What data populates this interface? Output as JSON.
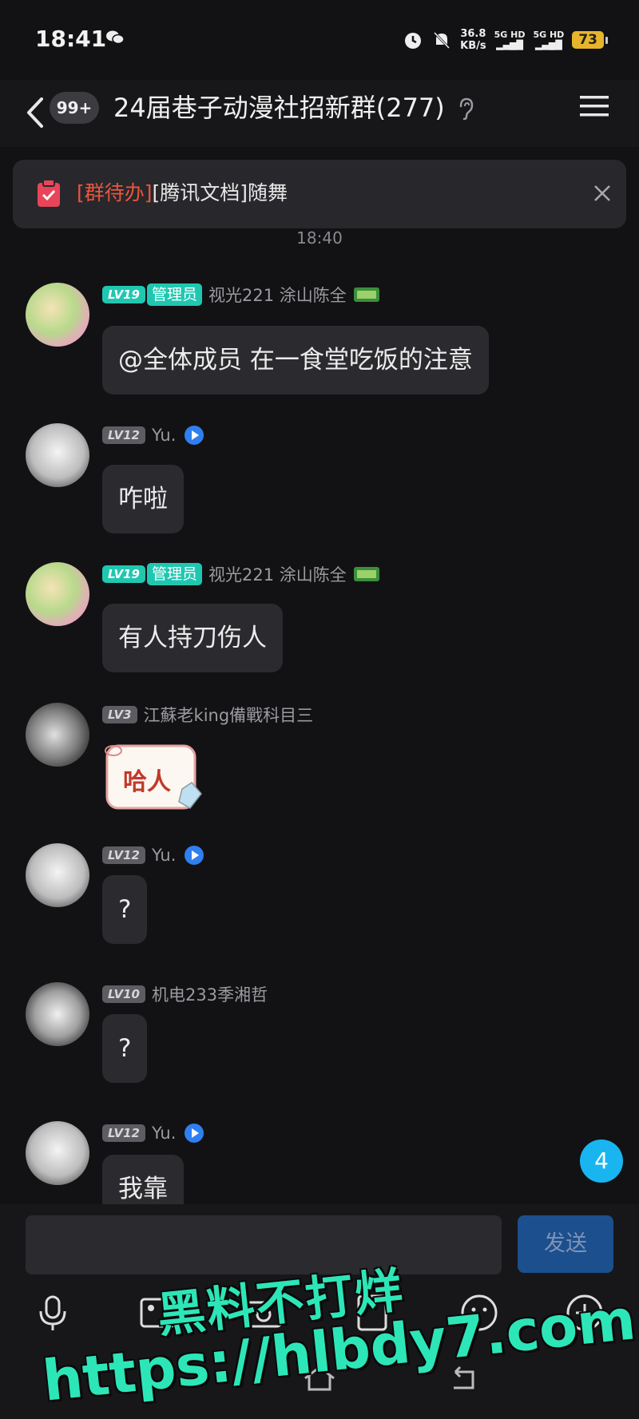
{
  "status": {
    "time": "18:41",
    "speed_value": "36.8",
    "speed_unit": "KB/s",
    "sim1": "5G HD",
    "sim2": "5G HD",
    "battery": "73"
  },
  "header": {
    "unread": "99+",
    "title": "24届巷子动漫社招新群(277)"
  },
  "todo": {
    "tag": "[群待办]",
    "text": "[腾讯文档]随舞"
  },
  "timestamp": "18:40",
  "messages": [
    {
      "level": "LV19",
      "role": "管理员",
      "sender": "视光221 涂山陈全",
      "text": "@全体成员 在一食堂吃饭的注意"
    },
    {
      "level": "LV12",
      "sender": "Yu.",
      "text": "咋啦"
    },
    {
      "level": "LV19",
      "role": "管理员",
      "sender": "视光221 涂山陈全",
      "text": "有人持刀伤人"
    },
    {
      "level": "LV3",
      "sender": "江蘇老king備戰科目三",
      "sticker_text": "哈人"
    },
    {
      "level": "LV12",
      "sender": "Yu.",
      "text": "?"
    },
    {
      "level": "LV10",
      "sender": "机电233季湘哲",
      "text": "?"
    },
    {
      "level": "LV12",
      "sender": "Yu.",
      "text": "我靠"
    }
  ],
  "new_count": "4",
  "input": {
    "send_label": "发送"
  },
  "watermark": {
    "line1": "黑料不打烊",
    "line2": "https://hlbdy7.com"
  },
  "colors": {
    "background": "#121214",
    "bubble": "#2b2b2f",
    "admin_badge": "#20c7b0",
    "todo_tag": "#e9553d",
    "send_button": "#1c4f8e",
    "float_badge": "#19b5f0"
  }
}
